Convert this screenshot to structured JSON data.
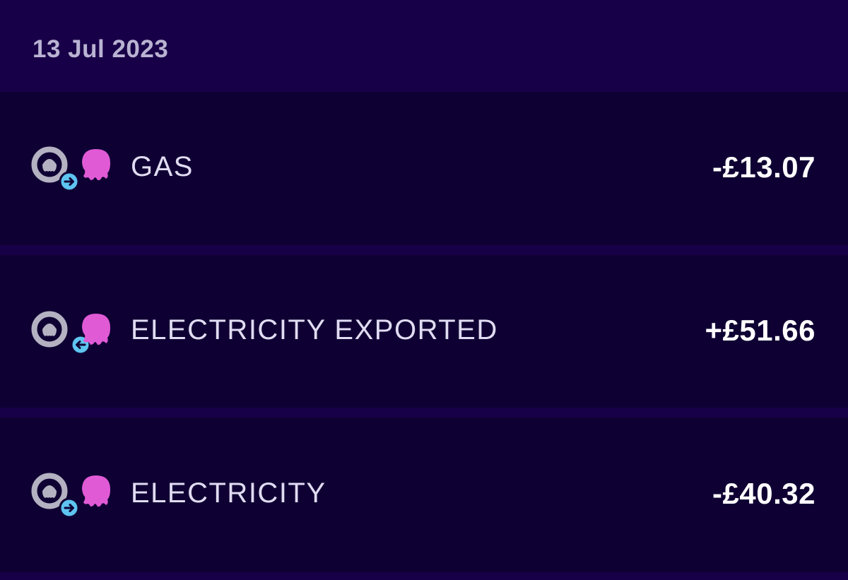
{
  "date_header": "13 Jul 2023",
  "colors": {
    "background": "#180048",
    "row_background": "#0f0033",
    "ring": "#b4b2c2",
    "octopus": "#e05ad6",
    "arrow_badge": "#5ec4f0"
  },
  "transactions": [
    {
      "label": "GAS",
      "amount": "-£13.07",
      "icons": [
        "octopus-ring-icon",
        "arrow-right-icon",
        "octopus-icon"
      ]
    },
    {
      "label": "ELECTRICITY EXPORTED",
      "amount": "+£51.66",
      "icons": [
        "octopus-ring-icon",
        "arrow-left-icon",
        "octopus-icon"
      ]
    },
    {
      "label": "ELECTRICITY",
      "amount": "-£40.32",
      "icons": [
        "octopus-ring-icon",
        "arrow-right-icon",
        "octopus-icon"
      ]
    }
  ]
}
